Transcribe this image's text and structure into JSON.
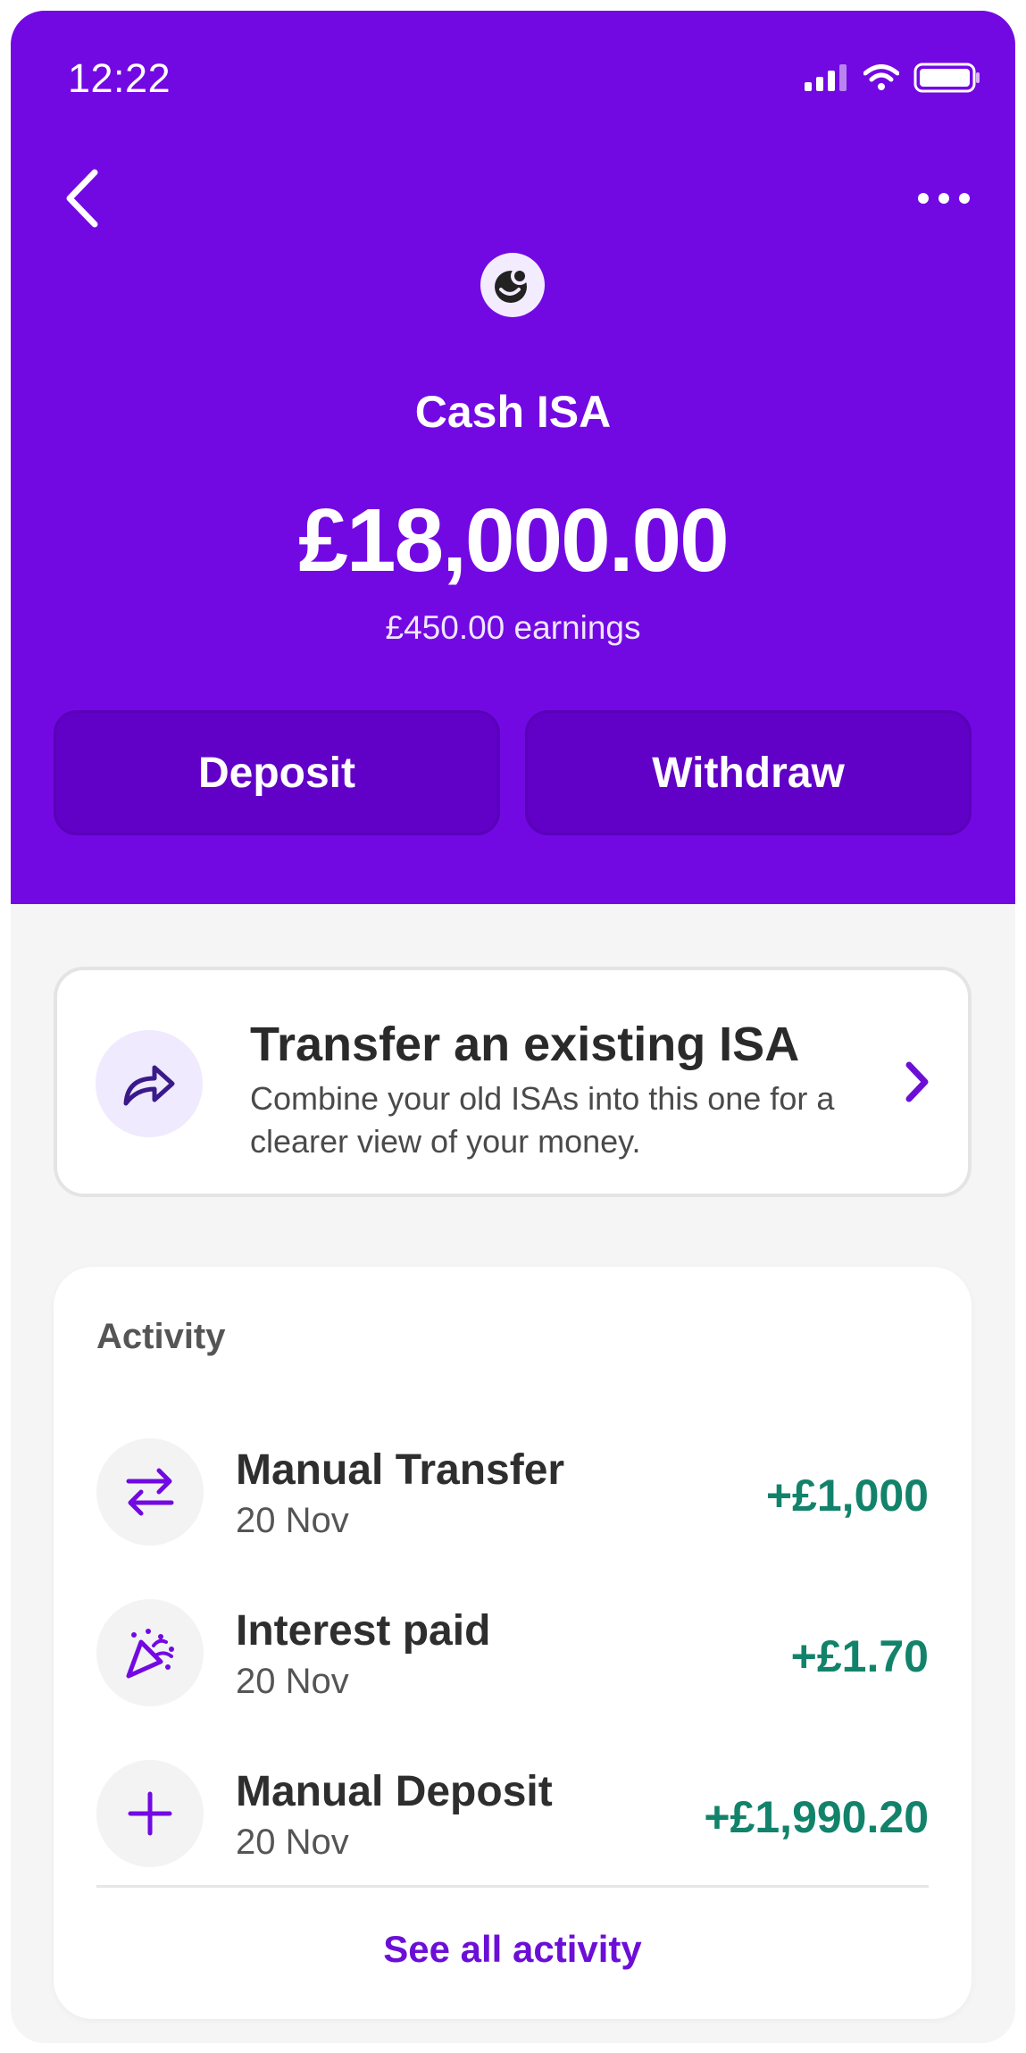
{
  "status_bar": {
    "time": "12:22"
  },
  "account": {
    "title": "Cash ISA",
    "balance": "£18,000.00",
    "earnings": "£450.00 earnings"
  },
  "actions": {
    "deposit_label": "Deposit",
    "withdraw_label": "Withdraw"
  },
  "transfer_promo": {
    "title": "Transfer an existing ISA",
    "description": "Combine your old ISAs into this one for a clearer view of your money."
  },
  "activity": {
    "heading": "Activity",
    "items": [
      {
        "title": "Manual Transfer",
        "date": "20 Nov",
        "amount": "+£1,000",
        "icon": "transfer-arrows-icon"
      },
      {
        "title": "Interest paid",
        "date": "20 Nov",
        "amount": "+£1.70",
        "icon": "party-popper-icon"
      },
      {
        "title": "Manual Deposit",
        "date": "20 Nov",
        "amount": "+£1,990.20",
        "icon": "plus-icon"
      }
    ],
    "see_all_label": "See all activity"
  },
  "colors": {
    "brand_purple": "#7209e3",
    "button_purple": "#6100c7",
    "positive_green": "#12836a",
    "link_purple": "#6c0fd6"
  }
}
